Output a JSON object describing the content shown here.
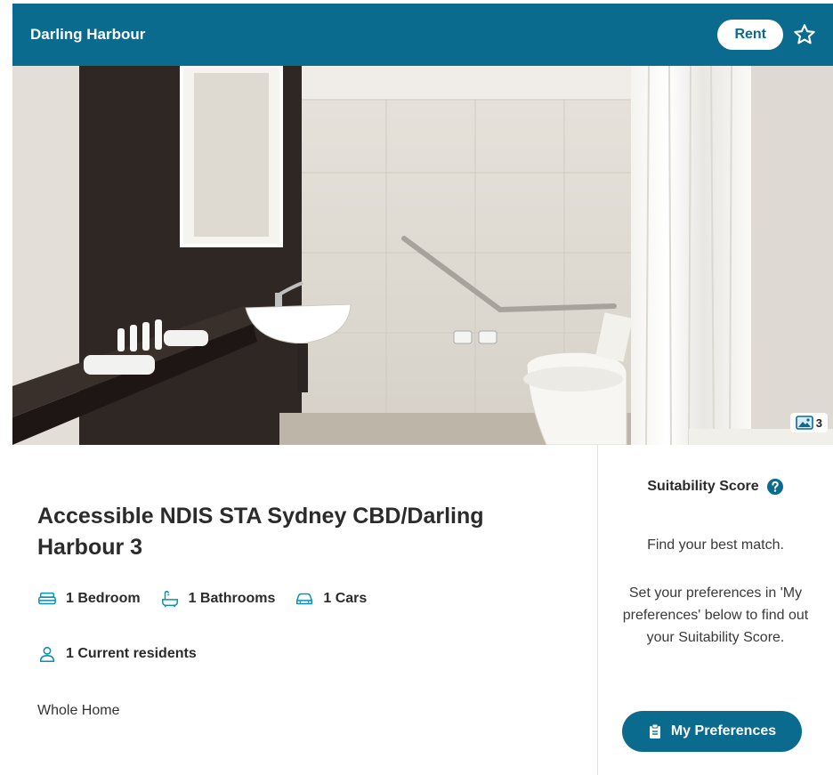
{
  "header": {
    "title": "Darling Harbour",
    "badge": "Rent",
    "favorite_icon": "star-outline-icon"
  },
  "photo": {
    "count": "3",
    "count_icon": "image-icon"
  },
  "listing": {
    "title": "Accessible NDIS STA Sydney CBD/Darling Harbour 3",
    "features": [
      {
        "icon": "bed-icon",
        "label": "1 Bedroom"
      },
      {
        "icon": "bath-icon",
        "label": "1 Bathrooms"
      },
      {
        "icon": "car-icon",
        "label": "1 Cars"
      }
    ],
    "residents": {
      "icon": "person-icon",
      "label": "1 Current residents"
    },
    "home_type": "Whole Home"
  },
  "suitability": {
    "title": "Suitability Score",
    "help_icon": "question-circle-icon",
    "subtitle": "Find your best match.",
    "description": "Set your preferences in 'My preferences' below to find out your Suitability Score.",
    "button_label": "My Preferences",
    "button_icon": "clipboard-icon"
  },
  "colors": {
    "primary": "#0a6b8f",
    "text": "#2b2b2b",
    "background": "#ffffff"
  }
}
